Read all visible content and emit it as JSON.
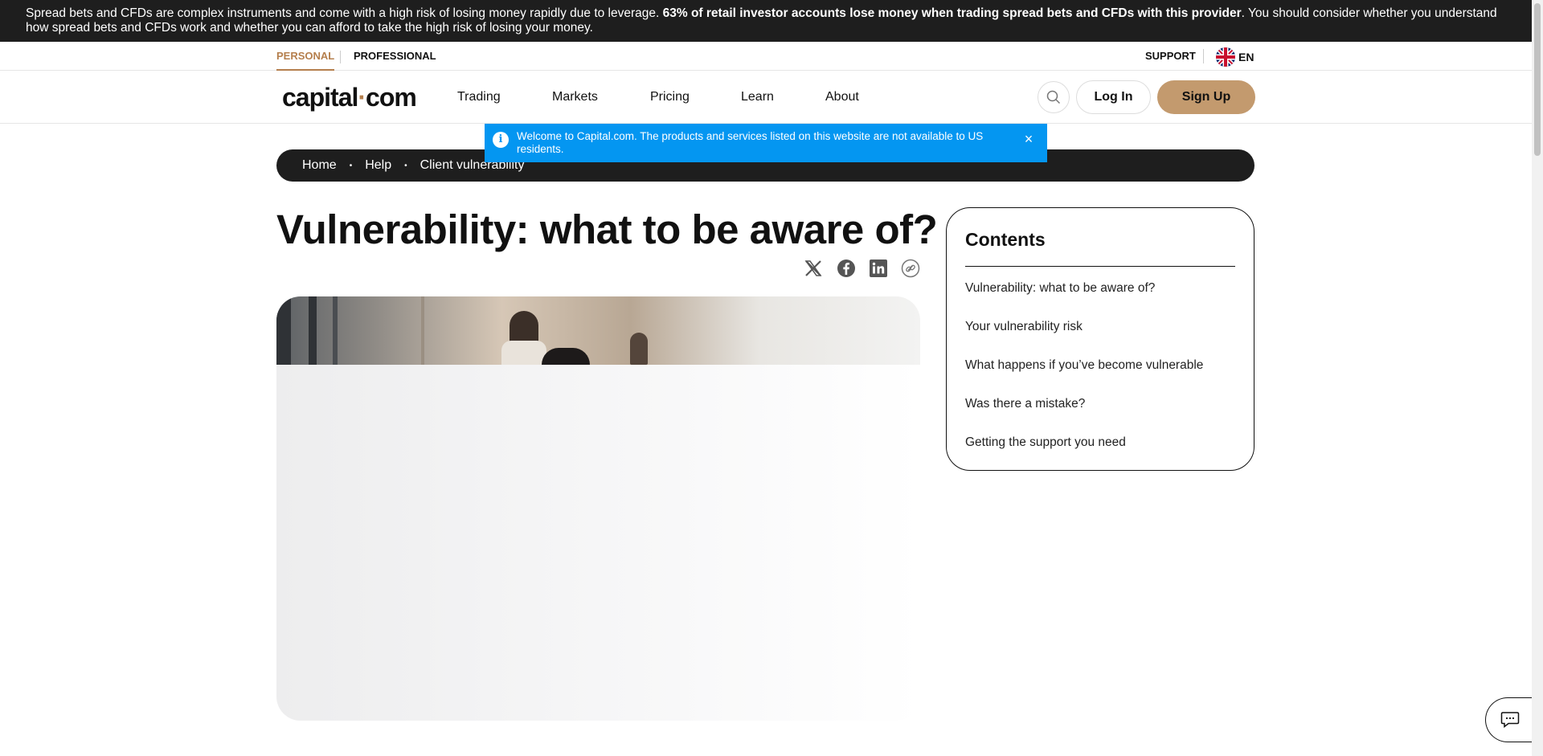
{
  "risk_warning": {
    "text_before": "Spread bets and CFDs are complex instruments and come with a high risk of losing money rapidly due to leverage. ",
    "text_bold": "63% of retail investor accounts lose money when trading spread bets and CFDs with this provider",
    "text_after": ". You should consider whether you understand how spread bets and CFDs work and whether you can afford to take the high risk of losing your money."
  },
  "top_links": {
    "personal": "PERSONAL",
    "professional": "PROFESSIONAL",
    "support": "SUPPORT",
    "language": "EN"
  },
  "nav": {
    "logo_left": "capital",
    "logo_dot": "·",
    "logo_right": "com",
    "items": [
      "Trading",
      "Markets",
      "Pricing",
      "Learn",
      "About"
    ],
    "login": "Log In",
    "signup": "Sign Up"
  },
  "notice": {
    "text": "Welcome to Capital.com. The products and services listed on this website are not available to US residents.",
    "info_glyph": "i",
    "close_glyph": "×"
  },
  "breadcrumb": {
    "items": [
      "Home",
      "Help",
      "Client vulnerability"
    ],
    "separator": "•"
  },
  "article": {
    "title": "Vulnerability: what to be aware of?"
  },
  "share_icons": [
    "x-icon",
    "facebook-icon",
    "linkedin-icon",
    "copy-link-icon"
  ],
  "contents": {
    "heading": "Contents",
    "items": [
      "Vulnerability: what to be aware of?",
      "Your vulnerability risk",
      "What happens if you’ve become vulnerable",
      "Was there a mistake?",
      "Getting the support you need"
    ]
  },
  "colors": {
    "brand_accent": "#b57f4d",
    "signup_bg": "#c39a6e",
    "notice_bg": "#0496f1",
    "dark_bar": "#1e1e1e"
  }
}
